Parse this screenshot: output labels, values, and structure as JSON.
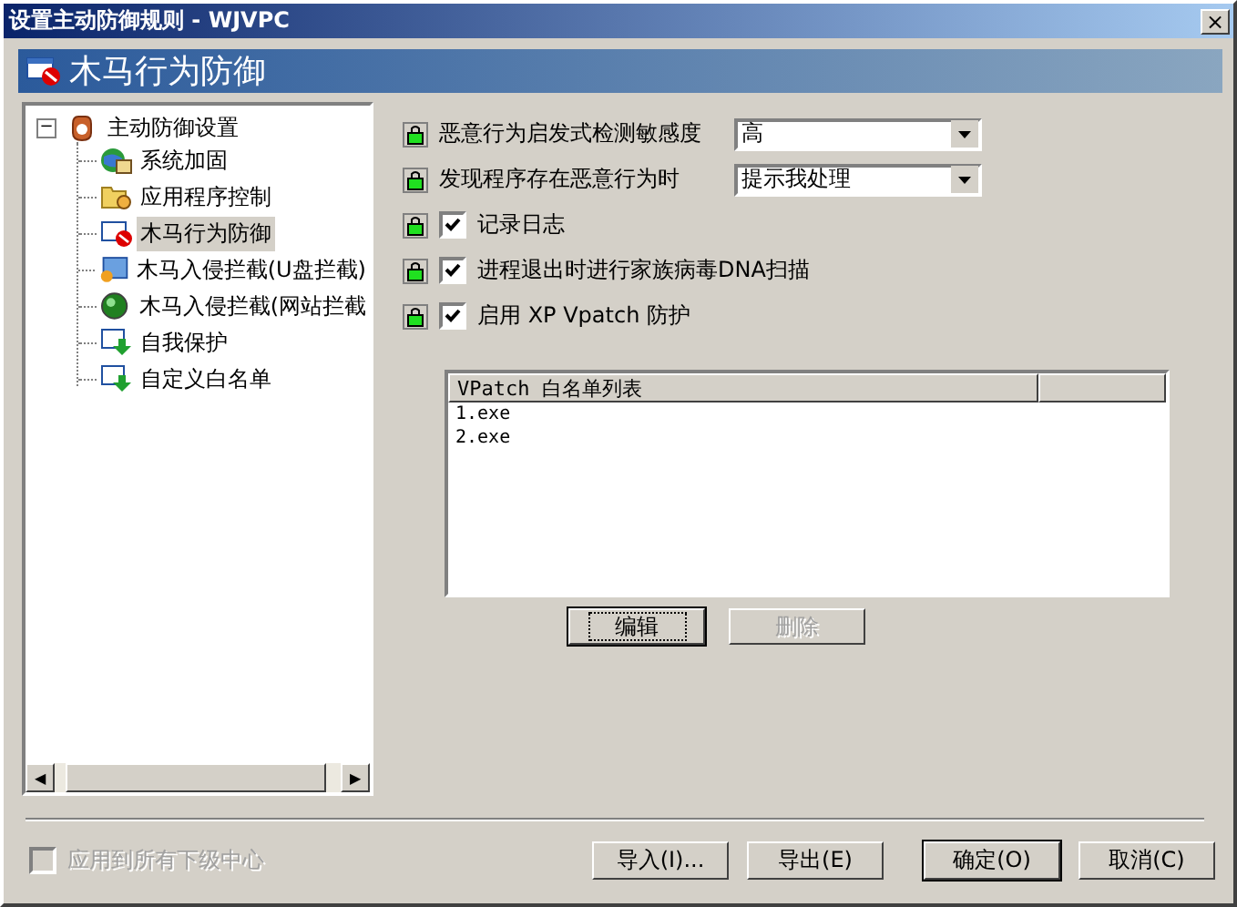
{
  "window": {
    "title": "设置主动防御规则 - WJVPC",
    "close": "×"
  },
  "header": {
    "title": "木马行为防御"
  },
  "tree": {
    "root": {
      "label": "主动防御设置",
      "expanded": true,
      "expander": "−",
      "children": [
        {
          "label": "系统加固",
          "selected": false
        },
        {
          "label": "应用程序控制",
          "selected": false
        },
        {
          "label": "木马行为防御",
          "selected": true
        },
        {
          "label": "木马入侵拦截(U盘拦截)",
          "selected": false
        },
        {
          "label": "木马入侵拦截(网站拦截",
          "selected": false
        },
        {
          "label": "自我保护",
          "selected": false
        },
        {
          "label": "自定义白名单",
          "selected": false
        }
      ]
    },
    "scroll_left": "◀",
    "scroll_right": "▶"
  },
  "settings": [
    {
      "kind": "dropdown",
      "label": "恶意行为启发式检测敏感度",
      "value": "高"
    },
    {
      "kind": "dropdown",
      "label": "发现程序存在恶意行为时",
      "value": "提示我处理"
    },
    {
      "kind": "checkbox",
      "label": "记录日志",
      "checked": true
    },
    {
      "kind": "checkbox",
      "label": "进程退出时进行家族病毒DNA扫描",
      "checked": true
    },
    {
      "kind": "checkbox",
      "label": "启用 XP Vpatch 防护",
      "checked": true
    }
  ],
  "whitelist": {
    "column": "VPatch 白名单列表",
    "rows": [
      "1.exe",
      "2.exe"
    ]
  },
  "list_buttons": [
    {
      "label": "编辑",
      "disabled": false,
      "focused": true
    },
    {
      "label": "删除",
      "disabled": true,
      "focused": false
    }
  ],
  "apply_all": {
    "label": "应用到所有下级中心",
    "checked": false,
    "disabled": true
  },
  "buttons": [
    {
      "label": "导入(I)...",
      "default": false
    },
    {
      "label": "导出(E)",
      "default": false
    },
    {
      "label": "确定(O)",
      "default": true
    },
    {
      "label": "取消(C)",
      "default": false
    }
  ]
}
